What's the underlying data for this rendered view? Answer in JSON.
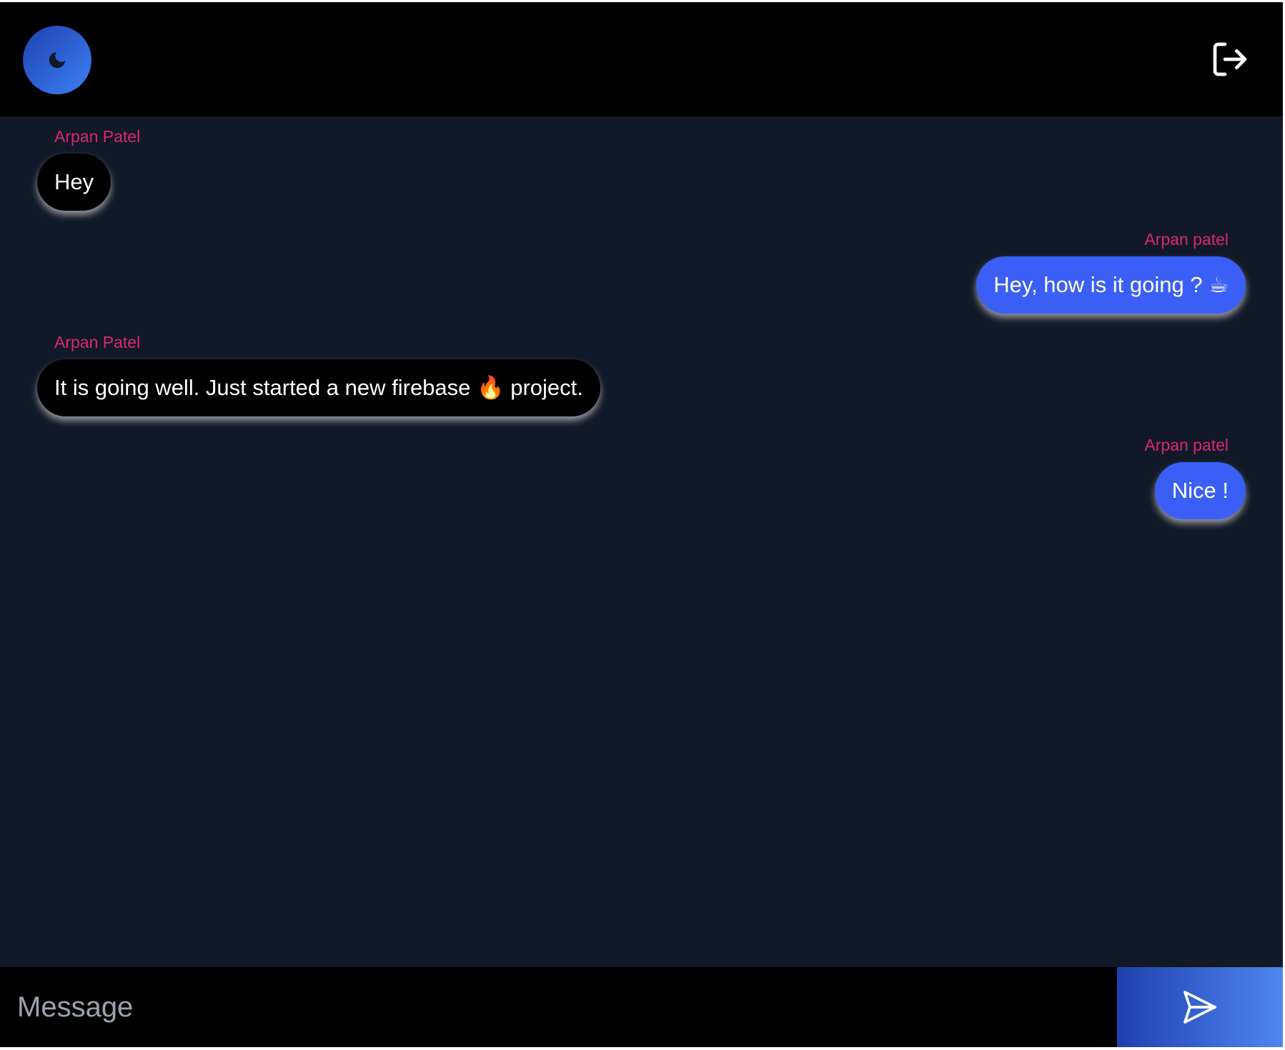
{
  "header": {
    "theme_icon": "moon-icon",
    "logout_icon": "logout-icon"
  },
  "messages": [
    {
      "sender": "Arpan Patel",
      "text": "Hey",
      "side": "left"
    },
    {
      "sender": "Arpan patel",
      "text": "Hey, how is it going ? ☕",
      "side": "right"
    },
    {
      "sender": "Arpan Patel",
      "text": "It is going well. Just started a new firebase 🔥 project.",
      "side": "left"
    },
    {
      "sender": "Arpan patel",
      "text": "Nice !",
      "side": "right"
    }
  ],
  "composer": {
    "placeholder": "Message",
    "value": "",
    "send_icon": "send-icon"
  },
  "colors": {
    "background": "#111827",
    "header": "#000000",
    "sender_name": "#db2777",
    "own_bubble": "#3b5ff6",
    "other_bubble": "#000000",
    "accent_gradient_start": "#1e40af",
    "accent_gradient_end": "#4f86f0"
  }
}
